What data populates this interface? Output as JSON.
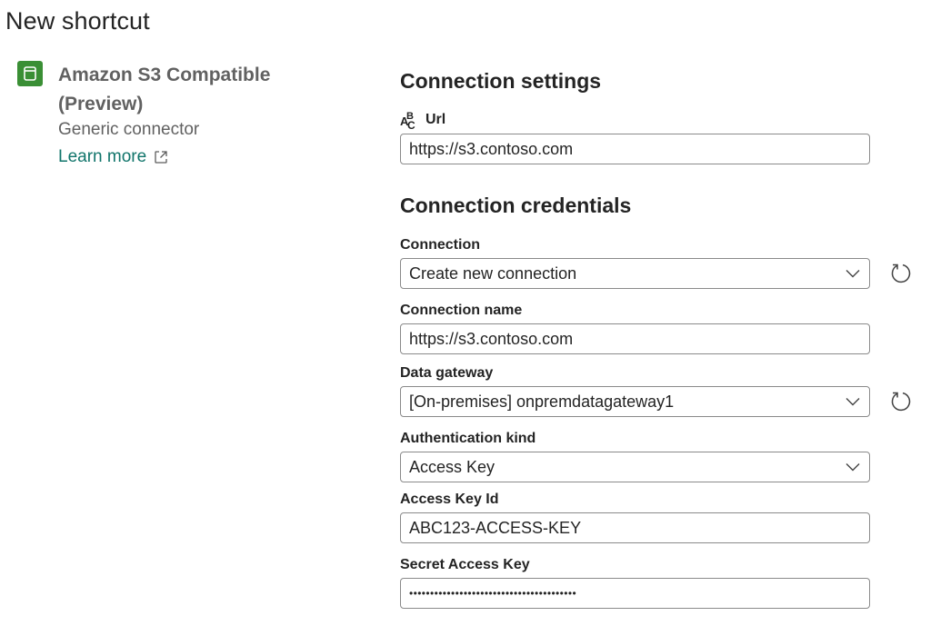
{
  "page": {
    "title": "New shortcut"
  },
  "connector": {
    "name_line1": "Amazon S3 Compatible",
    "name_line2": "(Preview)",
    "type": "Generic connector",
    "learn_more": "Learn more",
    "icon": "bucket-icon",
    "accent": "#3a8f35"
  },
  "settings": {
    "section_title": "Connection settings",
    "url_label": "Url",
    "url_value": "https://s3.contoso.com"
  },
  "credentials": {
    "section_title": "Connection credentials",
    "connection_label": "Connection",
    "connection_value": "Create new connection",
    "connection_name_label": "Connection name",
    "connection_name_value": "https://s3.contoso.com",
    "gateway_label": "Data gateway",
    "gateway_value": "[On-premises] onpremdatagateway1",
    "auth_label": "Authentication kind",
    "auth_value": "Access Key",
    "access_key_id_label": "Access Key Id",
    "access_key_id_value": "ABC123-ACCESS-KEY",
    "secret_label": "Secret Access Key",
    "secret_value": "••••••••••••••••••••••••••••••••••••••••"
  },
  "colors": {
    "link": "#11756b",
    "border": "#8a8a8a"
  }
}
